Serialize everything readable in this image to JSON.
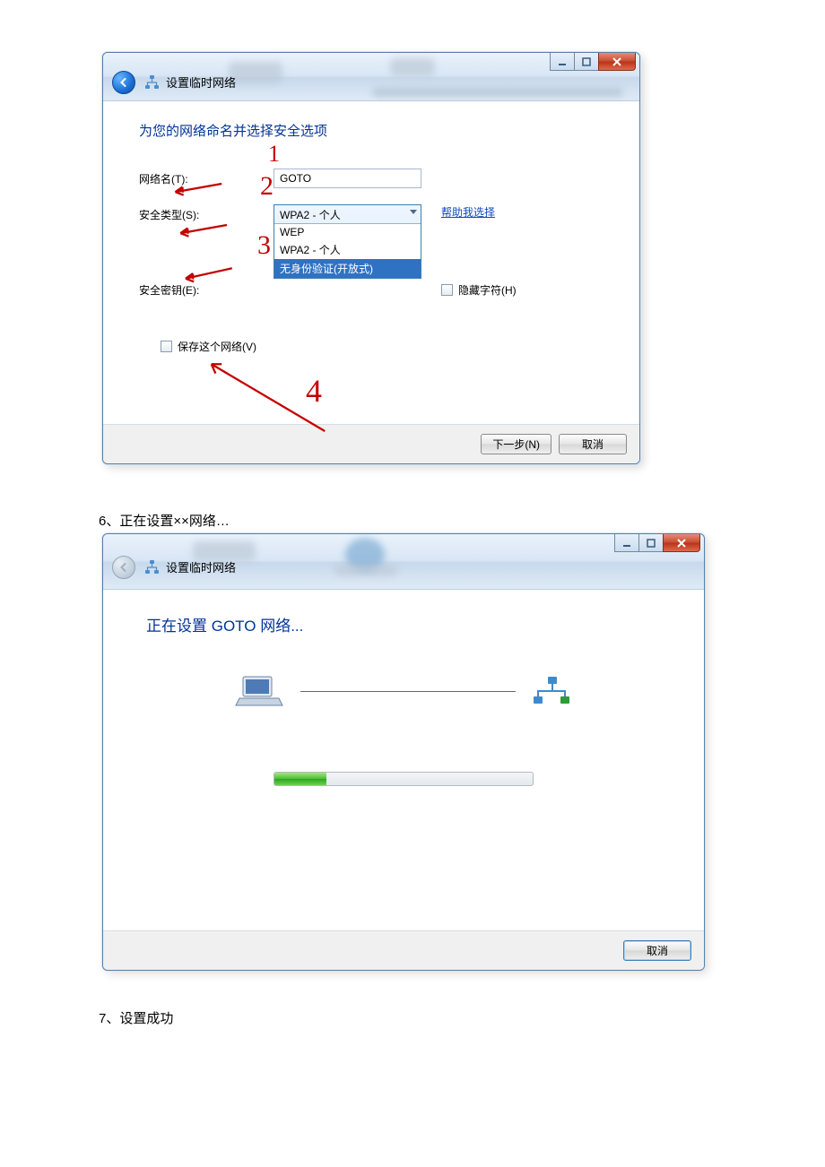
{
  "dialog1": {
    "window_title": "设置临时网络",
    "heading": "为您的网络命名并选择安全选项",
    "network_name_label": "网络名(T):",
    "network_name_value": "GOTO",
    "security_type_label": "安全类型(S):",
    "security_type_selected": "WPA2 - 个人",
    "security_options": {
      "opt0": "WEP",
      "opt1": "WPA2 - 个人",
      "opt2": "无身份验证(开放式)"
    },
    "help_link": "帮助我选择",
    "security_key_label": "安全密钥(E):",
    "hide_chars_label": "隐藏字符(H)",
    "save_network_label": "保存这个网络(V)",
    "next_button": "下一步(N)",
    "cancel_button": "取消",
    "annotations": {
      "a1": "1",
      "a2": "2",
      "a3": "3",
      "a4": "4"
    }
  },
  "step6_text": "6、正在设置××网络…",
  "dialog2": {
    "window_title": "设置临时网络",
    "heading": "正在设置 GOTO 网络...",
    "cancel_button": "取消"
  },
  "step7_text": "7、设置成功"
}
